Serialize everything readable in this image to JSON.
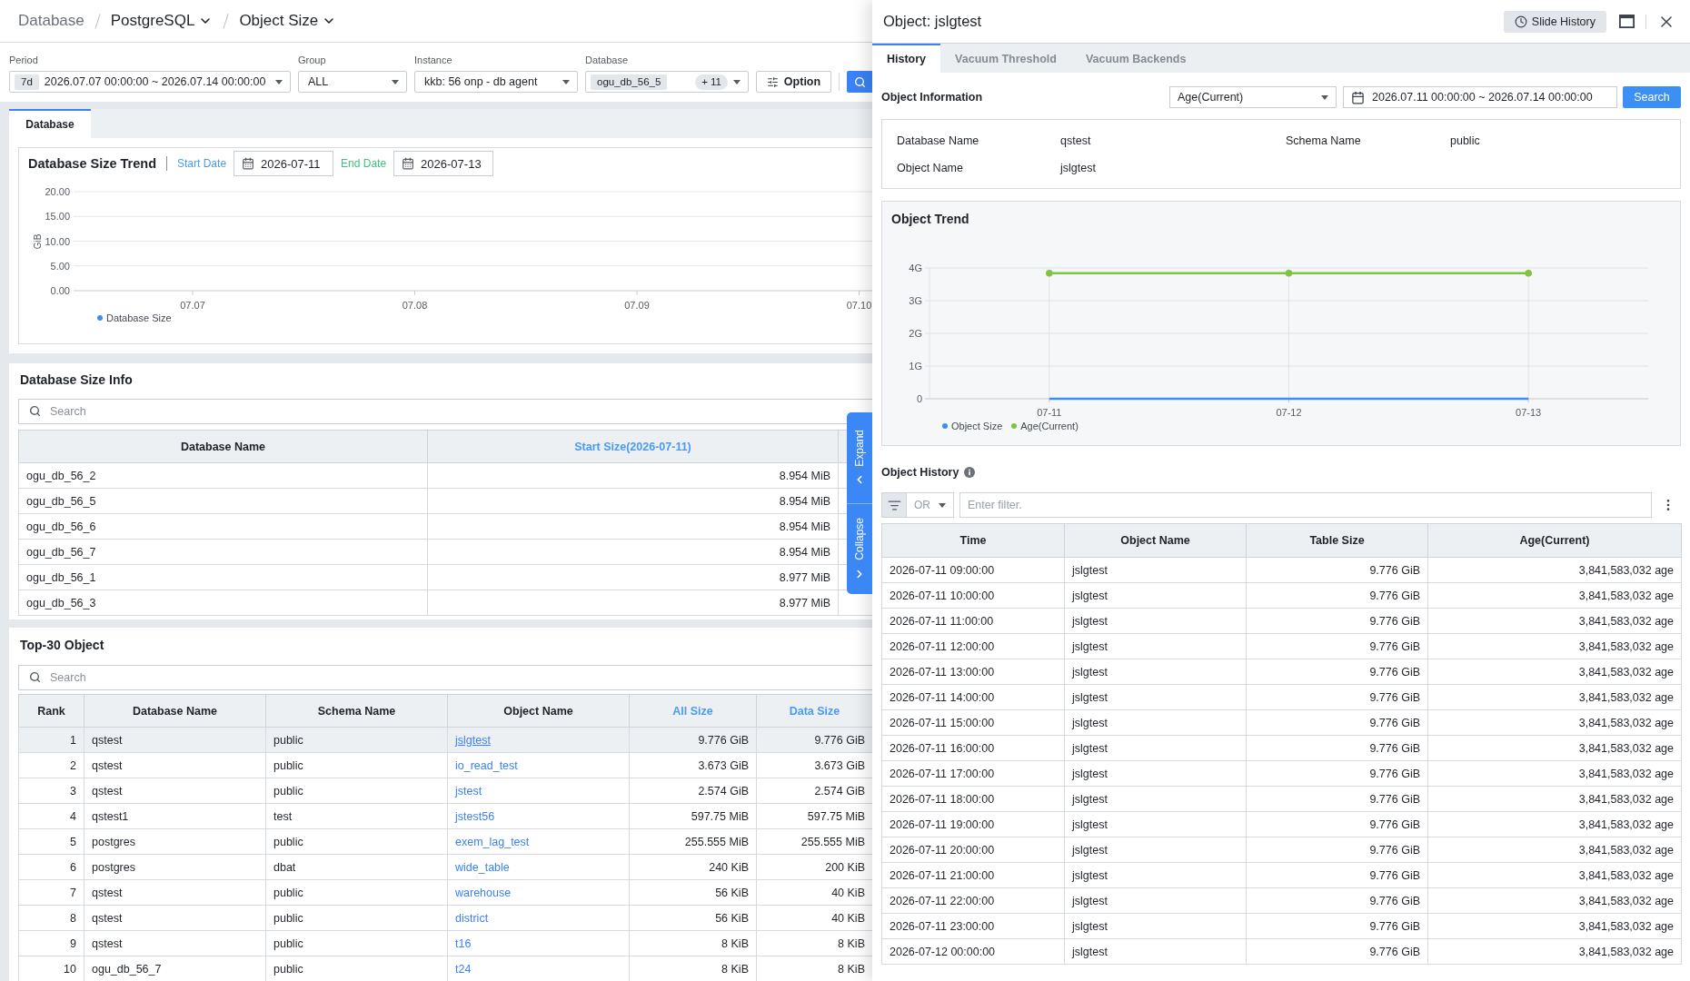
{
  "breadcrumb": [
    {
      "label": "Database",
      "dropdown": false
    },
    {
      "label": "PostgreSQL",
      "dropdown": true
    },
    {
      "label": "Object Size",
      "dropdown": true
    }
  ],
  "filters": [
    {
      "kind": "period",
      "label": "Period",
      "badge": "7d",
      "value": "2026.07.07 00:00:00 ~ 2026.07.14 00:00:00"
    },
    {
      "kind": "select",
      "label": "Group",
      "value": "ALL"
    },
    {
      "kind": "select",
      "label": "Instance",
      "value": "kkb: 56 onp - db agent"
    },
    {
      "kind": "multi",
      "label": "Database",
      "tag": "ogu_db_56_5",
      "more": "+ 11"
    }
  ],
  "option_button": {
    "label": "Option"
  },
  "main_tabs": [
    {
      "label": "Database",
      "selected": true
    }
  ],
  "size_trend": {
    "title": "Database Size Trend",
    "start_label": "Start Date",
    "start_date": "2026-07-11",
    "end_label": "End Date",
    "end_date": "2026-07-13",
    "chart_data": {
      "type": "line",
      "ylabel": "GiB",
      "categories": [
        "07.07",
        "07.08",
        "07.09",
        "07.10"
      ],
      "ylim": [
        0,
        20
      ],
      "yticks": [
        {
          "value": 0,
          "label": "0.00"
        },
        {
          "value": 5,
          "label": "5.00"
        },
        {
          "value": 10,
          "label": "10.00"
        },
        {
          "value": 15,
          "label": "15.00"
        },
        {
          "value": 20,
          "label": "20.00"
        }
      ],
      "grid": true,
      "series": [
        {
          "name": "Database Size",
          "color": "#3a8ef6",
          "values": [
            null,
            null,
            null,
            null
          ]
        }
      ]
    }
  },
  "size_info": {
    "title": "Database Size Info",
    "search": {
      "placeholder": "Search"
    },
    "columns": [
      {
        "label": "Database Name",
        "kind": "text",
        "highlighted": false
      },
      {
        "label": "Start Size(2026-07-11)",
        "kind": "number",
        "highlighted": true
      }
    ],
    "rows": [
      [
        "ogu_db_56_2",
        "8.954 MiB"
      ],
      [
        "ogu_db_56_5",
        "8.954 MiB"
      ],
      [
        "ogu_db_56_6",
        "8.954 MiB"
      ],
      [
        "ogu_db_56_7",
        "8.954 MiB"
      ],
      [
        "ogu_db_56_1",
        "8.977 MiB"
      ],
      [
        "ogu_db_56_3",
        "8.977 MiB"
      ]
    ]
  },
  "top_objects": {
    "title": "Top-30 Object",
    "search": {
      "placeholder": "Search"
    },
    "columns": [
      {
        "label": "Rank",
        "kind": "number",
        "highlighted": false
      },
      {
        "label": "Database Name",
        "kind": "text",
        "highlighted": false
      },
      {
        "label": "Schema Name",
        "kind": "text",
        "highlighted": false
      },
      {
        "label": "Object Name",
        "kind": "link",
        "highlighted": false
      },
      {
        "label": "All Size",
        "kind": "number",
        "highlighted": true
      },
      {
        "label": "Data Size",
        "kind": "number",
        "highlighted": true
      }
    ],
    "rows": [
      {
        "selected": true,
        "cells": [
          "1",
          "qstest",
          "public",
          "jslgtest",
          "9.776 GiB",
          "9.776 GiB"
        ]
      },
      {
        "selected": false,
        "cells": [
          "2",
          "qstest",
          "public",
          "io_read_test",
          "3.673 GiB",
          "3.673 GiB"
        ]
      },
      {
        "selected": false,
        "cells": [
          "3",
          "qstest",
          "public",
          "jstest",
          "2.574 GiB",
          "2.574 GiB"
        ]
      },
      {
        "selected": false,
        "cells": [
          "4",
          "qstest1",
          "test",
          "jstest56",
          "597.75 MiB",
          "597.75 MiB"
        ]
      },
      {
        "selected": false,
        "cells": [
          "5",
          "postgres",
          "public",
          "exem_lag_test",
          "255.555 MiB",
          "255.555 MiB"
        ]
      },
      {
        "selected": false,
        "cells": [
          "6",
          "postgres",
          "dbat",
          "wide_table",
          "240 KiB",
          "200 KiB"
        ]
      },
      {
        "selected": false,
        "cells": [
          "7",
          "qstest",
          "public",
          "warehouse",
          "56 KiB",
          "40 KiB"
        ]
      },
      {
        "selected": false,
        "cells": [
          "8",
          "qstest",
          "public",
          "district",
          "56 KiB",
          "40 KiB"
        ]
      },
      {
        "selected": false,
        "cells": [
          "9",
          "qstest",
          "public",
          "t16",
          "8 KiB",
          "8 KiB"
        ]
      },
      {
        "selected": false,
        "cells": [
          "10",
          "ogu_db_56_7",
          "public",
          "t24",
          "8 KiB",
          "8 KiB"
        ]
      }
    ]
  },
  "panel_toggles": [
    {
      "kind": "expand",
      "label": "Expand"
    },
    {
      "kind": "collapse",
      "label": "Collapse"
    }
  ],
  "drawer": {
    "title": "Object: jslgtest",
    "slide_history_button": {
      "label": "Slide History"
    },
    "tabs": [
      {
        "label": "History",
        "selected": true
      },
      {
        "label": "Vacuum Threshold",
        "selected": false
      },
      {
        "label": "Vacuum Backends",
        "selected": false
      }
    ],
    "object_information": {
      "title": "Object Information",
      "metric_select": {
        "value": "Age(Current)"
      },
      "date_range": {
        "value": "2026.07.11 00:00:00 ~ 2026.07.14 00:00:00"
      },
      "search_button": {
        "label": "Search"
      },
      "fields": [
        {
          "label": "Database Name",
          "value": "qstest"
        },
        {
          "label": "Schema Name",
          "value": "public"
        },
        {
          "label": "Object Name",
          "value": "jslgtest"
        }
      ]
    },
    "object_trend": {
      "title": "Object Trend",
      "chart_data": {
        "type": "line",
        "categories": [
          "07-11",
          "07-12",
          "07-13"
        ],
        "ylim": [
          0,
          4
        ],
        "yticks": [
          {
            "value": 0,
            "label": "0"
          },
          {
            "value": 1,
            "label": "1G"
          },
          {
            "value": 2,
            "label": "2G"
          },
          {
            "value": 3,
            "label": "3G"
          },
          {
            "value": 4,
            "label": "4G"
          }
        ],
        "grid": true,
        "series": [
          {
            "name": "Object Size",
            "color": "#3a8ef6",
            "values": [
              0,
              0,
              0
            ]
          },
          {
            "name": "Age(Current)",
            "color": "#80c342",
            "marker": "circle",
            "values": [
              3.84,
              3.84,
              3.84
            ]
          }
        ]
      }
    },
    "object_history": {
      "title": "Object History",
      "filter": {
        "operator": "OR",
        "placeholder": "Enter filter."
      },
      "columns": [
        {
          "label": "Time",
          "kind": "text"
        },
        {
          "label": "Object Name",
          "kind": "text"
        },
        {
          "label": "Table Size",
          "kind": "number"
        },
        {
          "label": "Age(Current)",
          "kind": "number"
        }
      ],
      "rows": [
        [
          "2026-07-11 09:00:00",
          "jslgtest",
          "9.776 GiB",
          "3,841,583,032 age"
        ],
        [
          "2026-07-11 10:00:00",
          "jslgtest",
          "9.776 GiB",
          "3,841,583,032 age"
        ],
        [
          "2026-07-11 11:00:00",
          "jslgtest",
          "9.776 GiB",
          "3,841,583,032 age"
        ],
        [
          "2026-07-11 12:00:00",
          "jslgtest",
          "9.776 GiB",
          "3,841,583,032 age"
        ],
        [
          "2026-07-11 13:00:00",
          "jslgtest",
          "9.776 GiB",
          "3,841,583,032 age"
        ],
        [
          "2026-07-11 14:00:00",
          "jslgtest",
          "9.776 GiB",
          "3,841,583,032 age"
        ],
        [
          "2026-07-11 15:00:00",
          "jslgtest",
          "9.776 GiB",
          "3,841,583,032 age"
        ],
        [
          "2026-07-11 16:00:00",
          "jslgtest",
          "9.776 GiB",
          "3,841,583,032 age"
        ],
        [
          "2026-07-11 17:00:00",
          "jslgtest",
          "9.776 GiB",
          "3,841,583,032 age"
        ],
        [
          "2026-07-11 18:00:00",
          "jslgtest",
          "9.776 GiB",
          "3,841,583,032 age"
        ],
        [
          "2026-07-11 19:00:00",
          "jslgtest",
          "9.776 GiB",
          "3,841,583,032 age"
        ],
        [
          "2026-07-11 20:00:00",
          "jslgtest",
          "9.776 GiB",
          "3,841,583,032 age"
        ],
        [
          "2026-07-11 21:00:00",
          "jslgtest",
          "9.776 GiB",
          "3,841,583,032 age"
        ],
        [
          "2026-07-11 22:00:00",
          "jslgtest",
          "9.776 GiB",
          "3,841,583,032 age"
        ],
        [
          "2026-07-11 23:00:00",
          "jslgtest",
          "9.776 GiB",
          "3,841,583,032 age"
        ],
        [
          "2026-07-12 00:00:00",
          "jslgtest",
          "9.776 GiB",
          "3,841,583,032 age"
        ]
      ]
    }
  }
}
